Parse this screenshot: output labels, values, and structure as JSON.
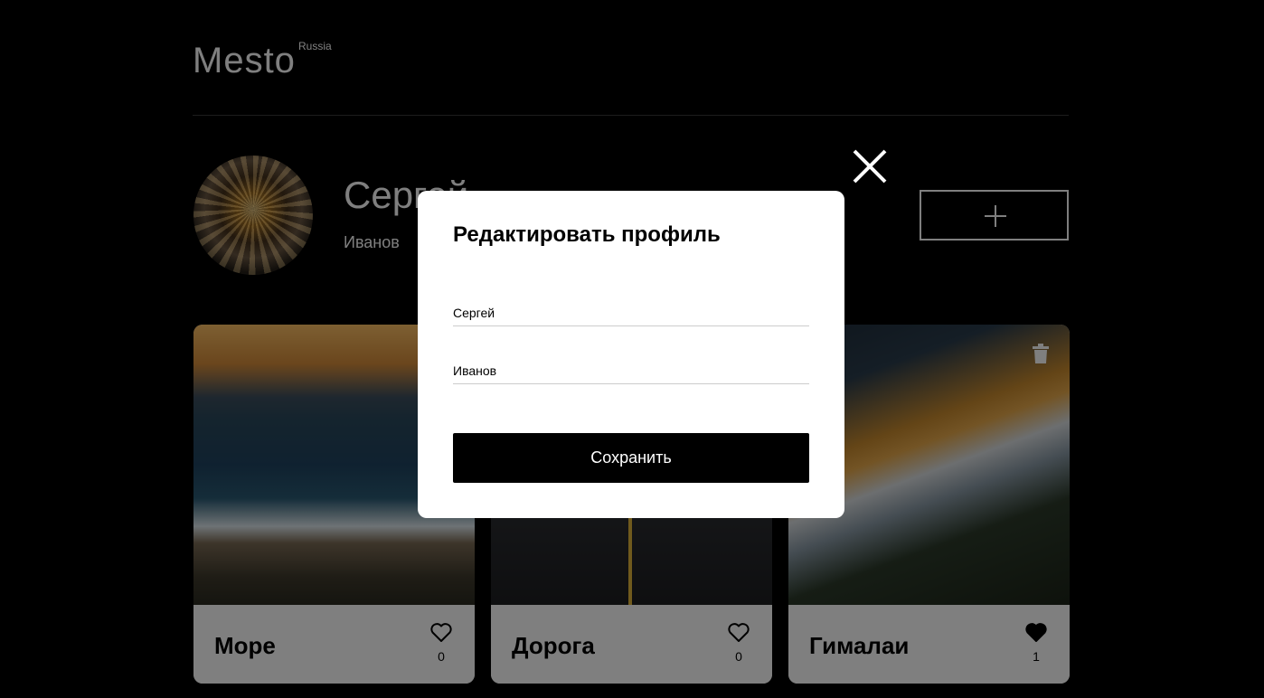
{
  "header": {
    "logo": "Mesto",
    "logo_sub": "Russia"
  },
  "profile": {
    "name": "Сергей",
    "job": "Иванов",
    "add_button_icon": "plus-icon"
  },
  "cards": [
    {
      "title": "Море",
      "likes": "0",
      "liked": false,
      "deletable": false
    },
    {
      "title": "Дорога",
      "likes": "0",
      "liked": false,
      "deletable": false
    },
    {
      "title": "Гималаи",
      "likes": "1",
      "liked": true,
      "deletable": true
    }
  ],
  "popup": {
    "title": "Редактировать профиль",
    "name_value": "Сергей",
    "job_value": "Иванов",
    "save_label": "Сохранить",
    "close_icon": "close-icon"
  },
  "colors": {
    "background": "#000000",
    "overlay": "rgba(0,0,0,0.5)",
    "accent": "#000000",
    "text_light": "#ffffff"
  }
}
